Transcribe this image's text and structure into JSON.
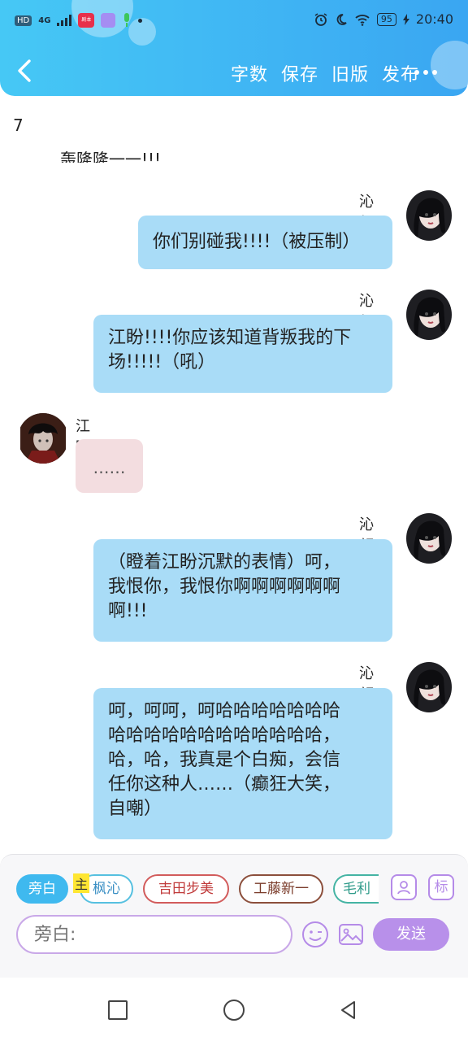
{
  "status_bar": {
    "hd": "HD",
    "network": "4G",
    "app_badge": "剧本",
    "battery": "95",
    "time": "20:40"
  },
  "header": {
    "actions": [
      "字数",
      "保存",
      "旧版",
      "发布"
    ],
    "accent_color": "#3aa6f2"
  },
  "chat": {
    "leading_number": "7",
    "cut_off_line": "轰隆隆一一!!!",
    "messages": [
      {
        "speaker": "沁颜",
        "side": "right",
        "text": "你们别碰我!!!!（被压制）"
      },
      {
        "speaker": "沁颜",
        "side": "right",
        "text_lines": [
          "江盼!!!!你应该知道背叛我的下",
          "场!!!!!（吼）"
        ]
      },
      {
        "speaker": "江盼",
        "side": "left",
        "text": "……"
      },
      {
        "speaker": "沁颜",
        "side": "right",
        "text_lines": [
          "（瞪着江盼沉默的表情）呵，",
          "我恨你，我恨你啊啊啊啊啊啊",
          "啊!!!"
        ]
      },
      {
        "speaker": "沁颜",
        "side": "right",
        "text_lines": [
          "呵，呵呵，呵哈哈哈哈哈哈哈",
          "哈哈哈哈哈哈哈哈哈哈哈哈，",
          "哈，哈，我真是个白痴，会信",
          "任你这种人……（癫狂大笑，",
          "自嘲）"
        ]
      }
    ]
  },
  "input_panel": {
    "role_chips": [
      "旁白",
      "枫沁",
      "吉田步美",
      "工藤新一",
      "毛利"
    ],
    "main_tag": "主",
    "contacts_icon": "person-icon",
    "tag_label": "标",
    "input_placeholder": "旁白:",
    "send_label": "发送"
  }
}
